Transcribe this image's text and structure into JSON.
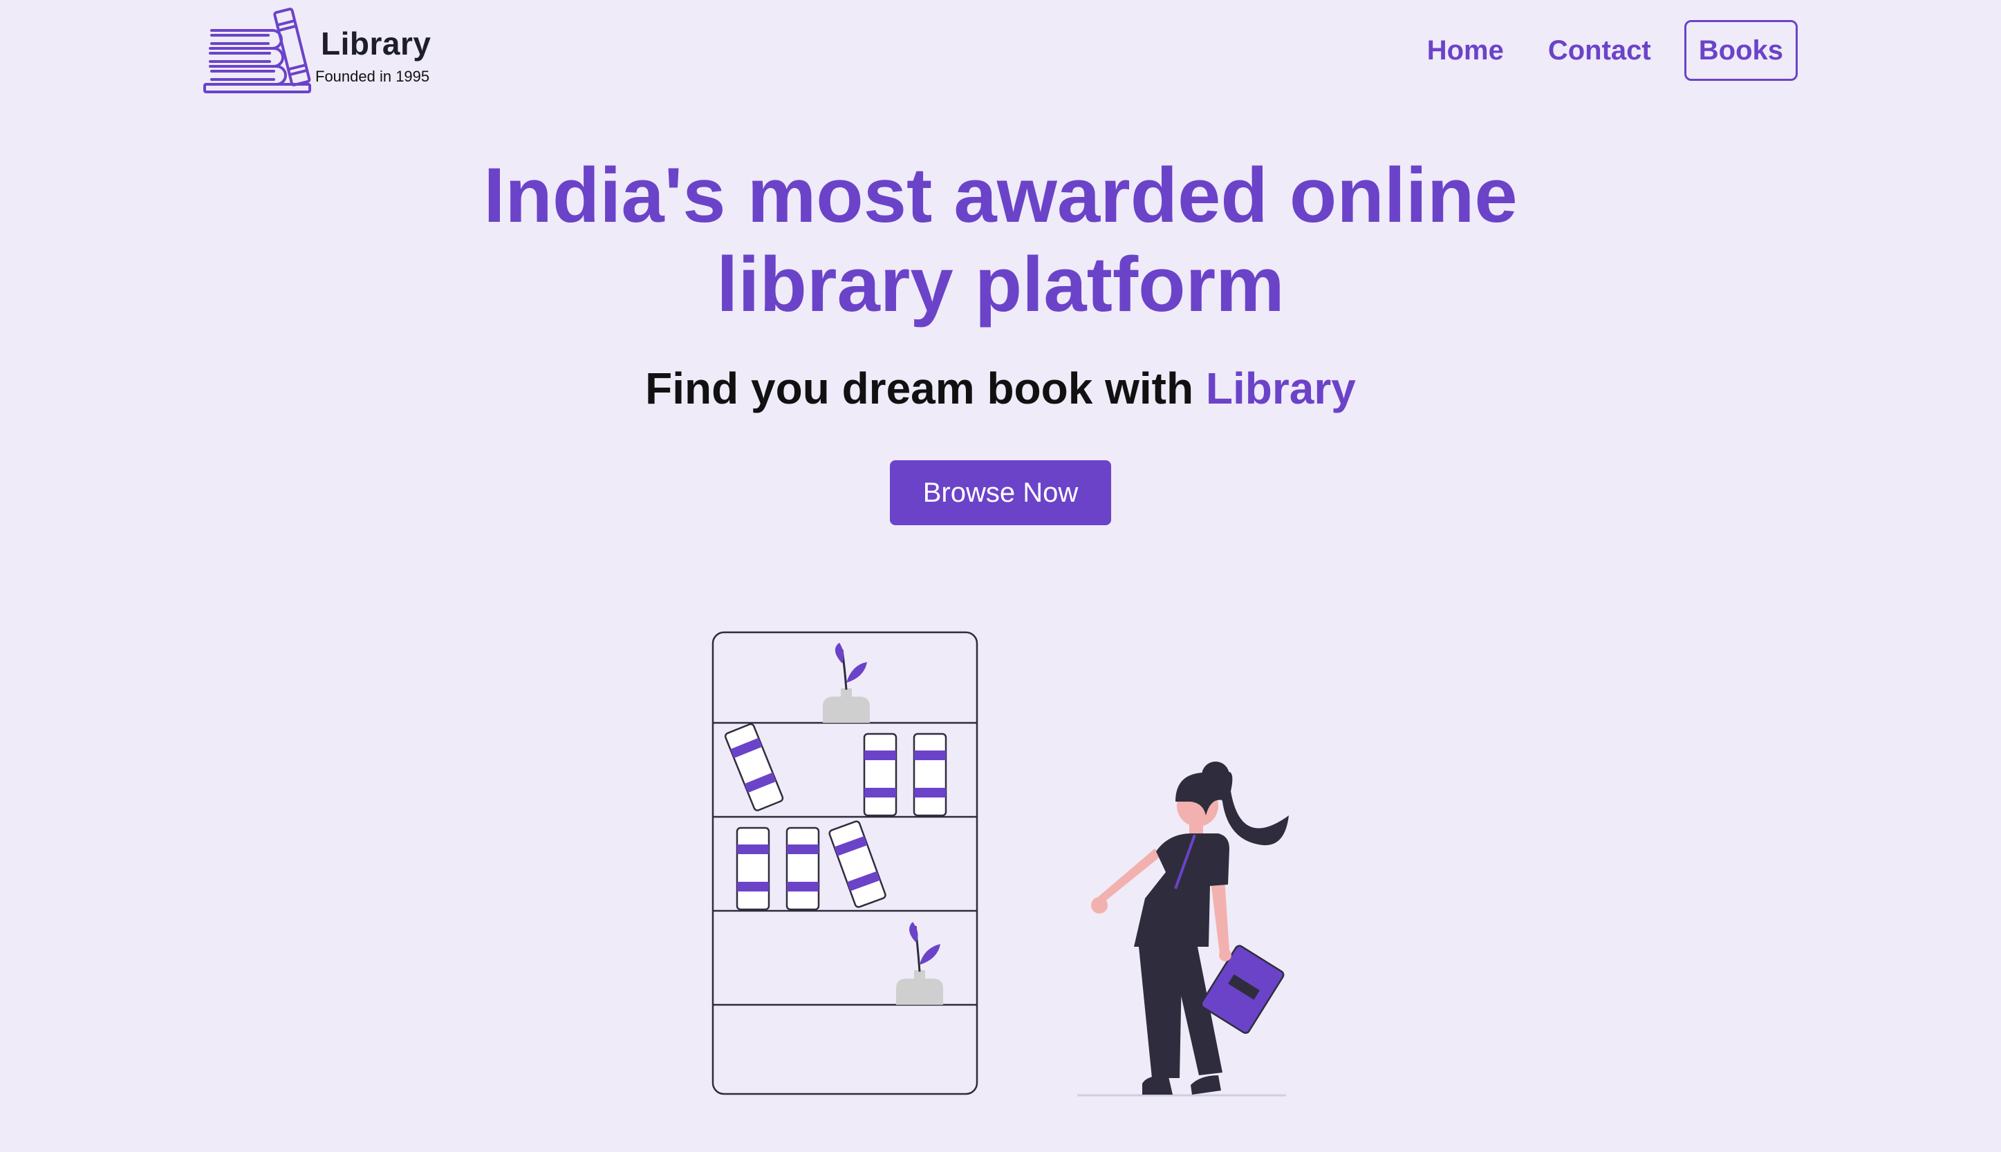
{
  "colors": {
    "background": "#efebf9",
    "accent": "#6b43c8",
    "dark_figure": "#2f2d3d",
    "skin": "#f2b1ae",
    "pot": "#cfcfcf"
  },
  "header": {
    "logo_icon": "books-stack-icon",
    "brand_name": "Library",
    "brand_tagline": "Founded in 1995",
    "nav": {
      "home": "Home",
      "contact": "Contact",
      "books": "Books"
    }
  },
  "hero": {
    "title_line1": "India's most awarded online",
    "title_line2": "library platform",
    "subtitle_prefix": "Find you dream book with ",
    "subtitle_accent": "Library",
    "cta": "Browse Now"
  },
  "illustration": {
    "bookshelf_icon": "bookshelf-illustration",
    "person_icon": "woman-holding-book-illustration"
  }
}
